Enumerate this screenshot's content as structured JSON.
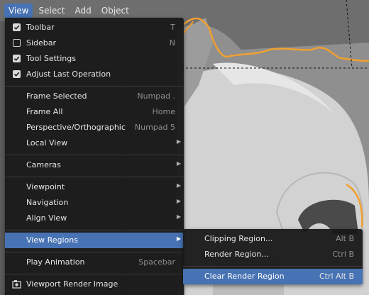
{
  "menubar": {
    "items": [
      {
        "label": "View"
      },
      {
        "label": "Select"
      },
      {
        "label": "Add"
      },
      {
        "label": "Object"
      }
    ]
  },
  "view_menu": {
    "toolbar": {
      "label": "Toolbar",
      "shortcut": "T",
      "checked": true
    },
    "sidebar": {
      "label": "Sidebar",
      "shortcut": "N",
      "checked": false
    },
    "tool_settings": {
      "label": "Tool Settings",
      "checked": true
    },
    "adjust_last_operation": {
      "label": "Adjust Last Operation",
      "checked": true
    },
    "frame_selected": {
      "label": "Frame Selected",
      "shortcut": "Numpad ."
    },
    "frame_all": {
      "label": "Frame All",
      "shortcut": "Home"
    },
    "perspective": {
      "label": "Perspective/Orthographic",
      "shortcut": "Numpad 5"
    },
    "local_view": {
      "label": "Local View"
    },
    "cameras": {
      "label": "Cameras"
    },
    "viewpoint": {
      "label": "Viewpoint"
    },
    "navigation": {
      "label": "Navigation"
    },
    "align_view": {
      "label": "Align View"
    },
    "view_regions": {
      "label": "View Regions"
    },
    "play_animation": {
      "label": "Play Animation",
      "shortcut": "Spacebar"
    },
    "viewport_render_image": {
      "label": "Viewport Render Image"
    }
  },
  "view_regions_submenu": {
    "clipping_region": {
      "label": "Clipping Region...",
      "shortcut": "Alt B"
    },
    "render_region": {
      "label": "Render Region...",
      "shortcut": "Ctrl B"
    },
    "clear_render_region": {
      "label": "Clear Render Region",
      "shortcut": "Ctrl Alt B"
    }
  },
  "colors": {
    "highlight": "#4772b3",
    "menu_bg": "#181818",
    "outline_orange": "#f0a030"
  }
}
